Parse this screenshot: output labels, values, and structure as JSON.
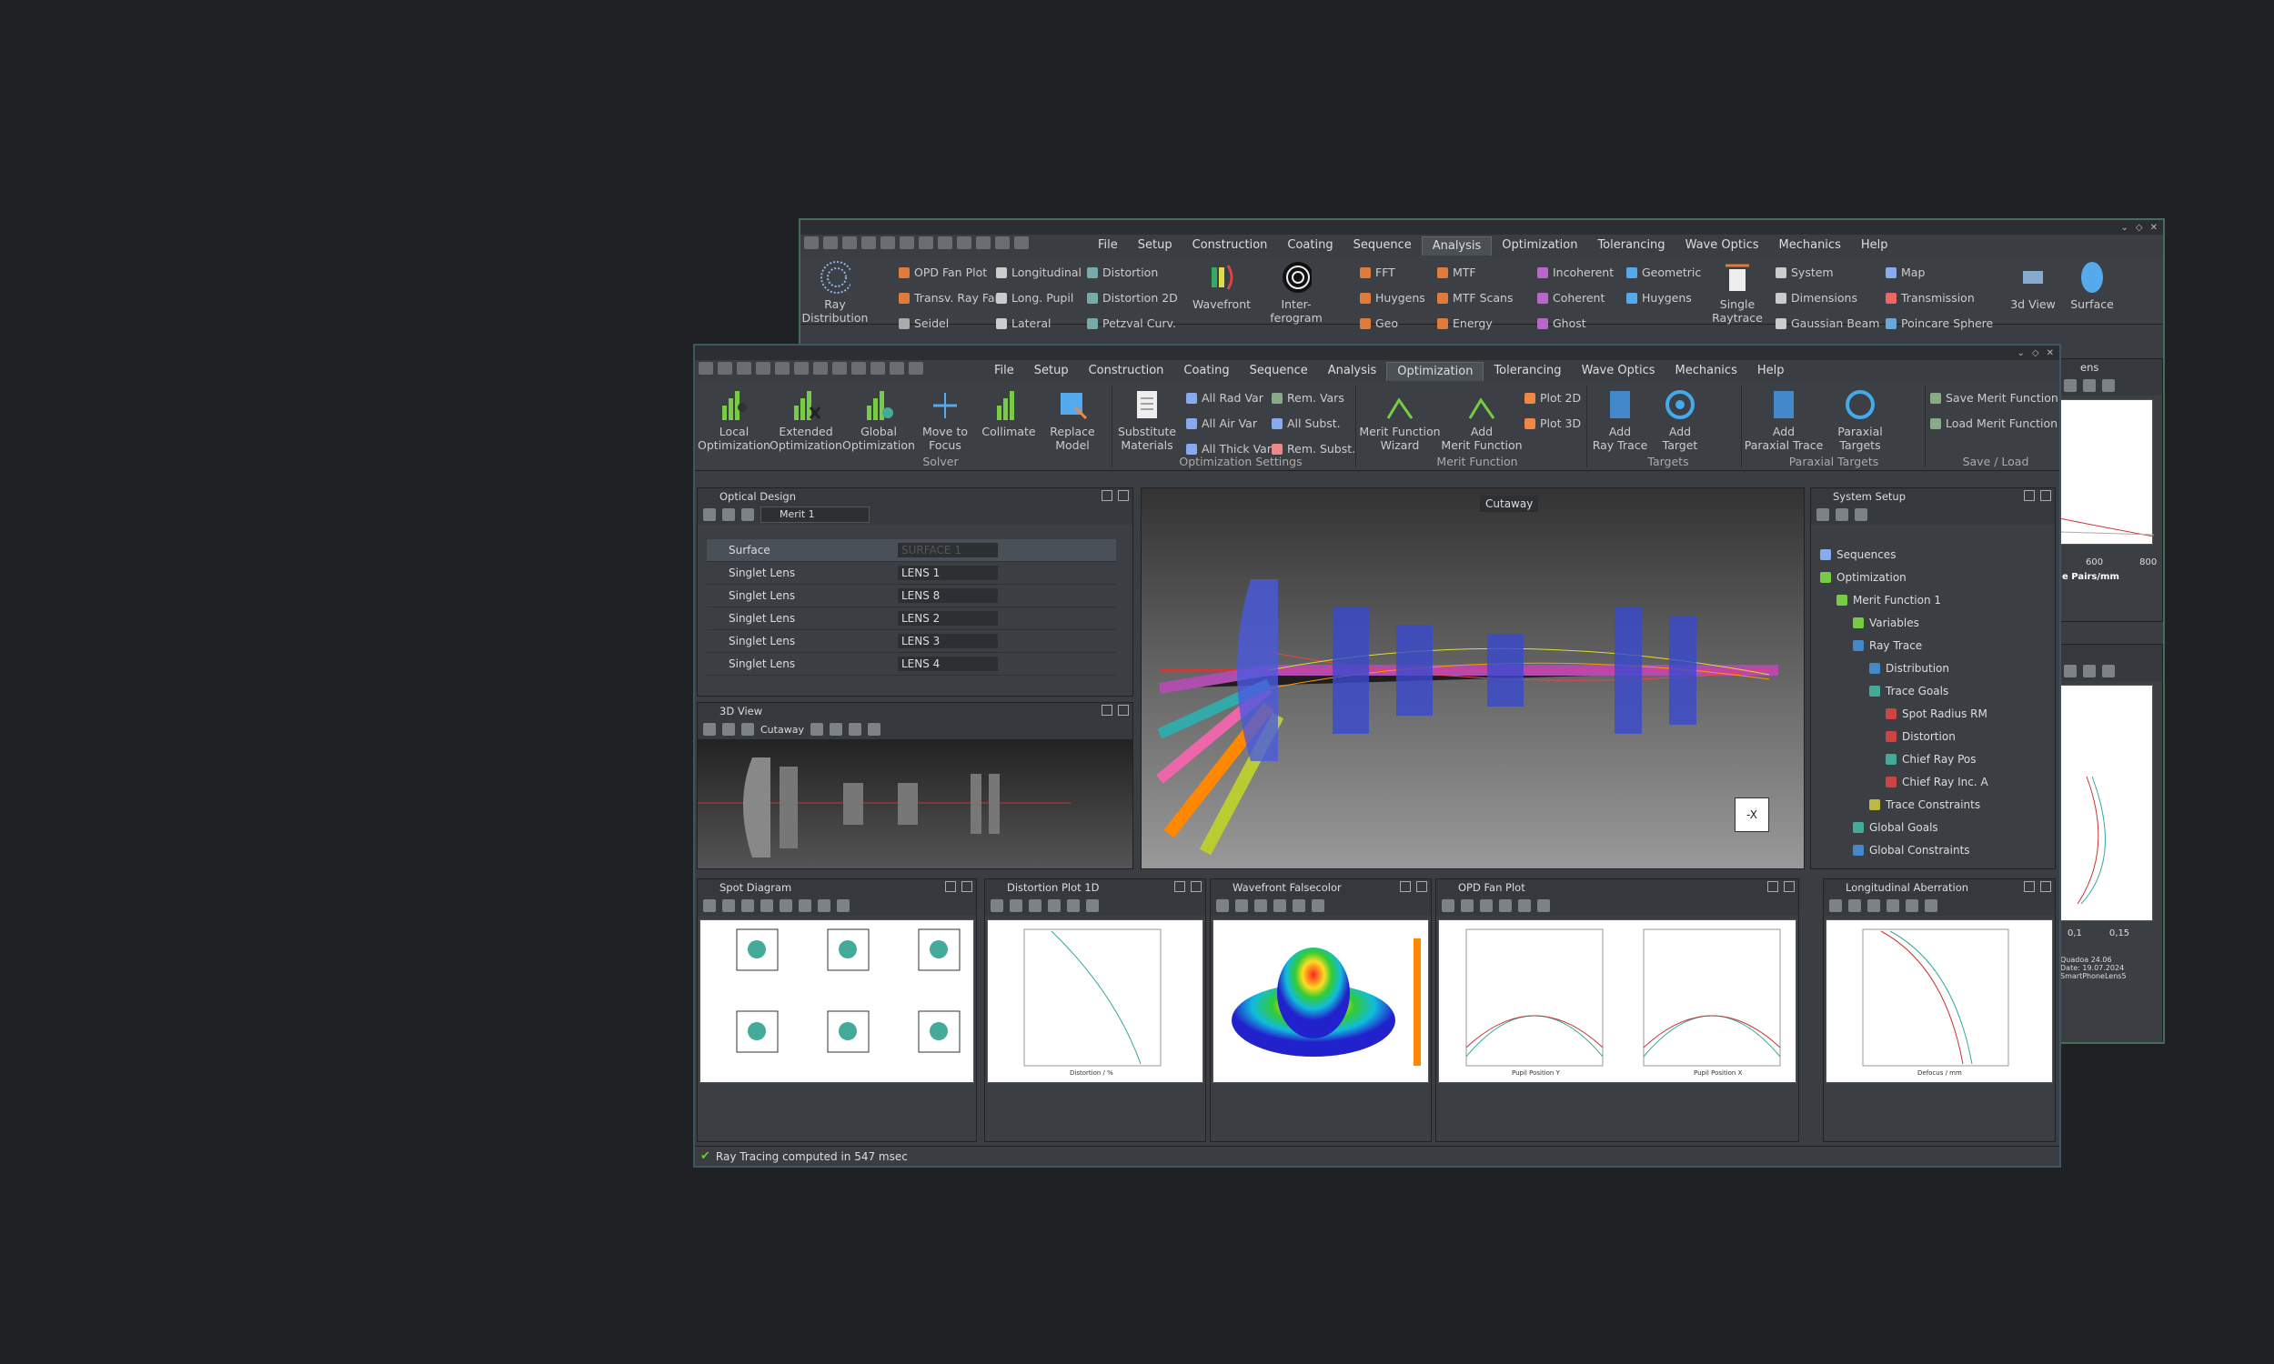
{
  "back": {
    "menu": [
      "File",
      "Setup",
      "Construction",
      "Coating",
      "Sequence",
      "Analysis",
      "Optimization",
      "Tolerancing",
      "Wave Optics",
      "Mechanics",
      "Help"
    ],
    "active": "Analysis",
    "buttons": {
      "ray_dist": "Ray\nDistribution",
      "wavefront": "Wavefront",
      "interferogram": "Inter-\nferogram",
      "single_raytrace": "Single\nRaytrace",
      "view3d": "3d View",
      "surface": "Surface"
    },
    "small": [
      "OPD Fan Plot",
      "Transv. Ray Fan",
      "Seidel",
      "Longitudinal",
      "Long. Pupil",
      "Lateral",
      "Distortion",
      "Distortion 2D",
      "Petzval Curv.",
      "FFT",
      "Huygens",
      "Geo",
      "MTF",
      "MTF Scans",
      "Energy",
      "Incoherent",
      "Coherent",
      "Ghost",
      "Geometric",
      "Huygens",
      "System",
      "Dimensions",
      "Gaussian Beam",
      "Map",
      "Transmission",
      "Poincare Sphere"
    ],
    "tab_label": "ens",
    "ticks": [
      "600",
      "800"
    ],
    "xlabel": "e Pairs/mm",
    "ticks2": [
      "0,1",
      "0,15"
    ],
    "foot": [
      "Quadoa 24.06",
      "Date: 19.07.2024",
      "SmartPhoneLens5"
    ]
  },
  "front": {
    "menu": [
      "File",
      "Setup",
      "Construction",
      "Coating",
      "Sequence",
      "Analysis",
      "Optimization",
      "Tolerancing",
      "Wave Optics",
      "Mechanics",
      "Help"
    ],
    "active": "Optimization",
    "buttons": {
      "local": "Local\nOptimization",
      "extended": "Extended\nOptimization",
      "global": "Global\nOptimization",
      "move": "Move to\nFocus",
      "collimate": "Collimate",
      "replace": "Replace\nModel",
      "substitute": "Substitute\nMaterials",
      "mfwizard": "Merit Function\nWizard",
      "addmf": "Add\nMerit Function",
      "addray": "Add\nRay Trace",
      "addtarget": "Add\nTarget",
      "addparaxial": "Add\nParaxial Trace",
      "paraxial": "Paraxial\nTargets"
    },
    "small": {
      "allrad": "All Rad Var",
      "allair": "All Air Var",
      "allthick": "All Thick Var",
      "remvars": "Rem. Vars",
      "allsubst": "All Subst.",
      "remsubst": "Rem. Subst.",
      "plot2d": "Plot 2D",
      "plot3d": "Plot 3D",
      "savemf": "Save Merit Function",
      "loadmf": "Load Merit Function"
    },
    "groups": {
      "solver": "Solver",
      "settings": "Optimization Settings",
      "merit": "Merit Function",
      "targets": "Targets",
      "paraxial": "Paraxial Targets",
      "saveload": "Save / Load"
    },
    "optical_design": {
      "title": "Optical Design",
      "merit": "Merit 1",
      "rows": [
        [
          "Surface",
          "SURFACE 1"
        ],
        [
          "Singlet Lens",
          "LENS 1"
        ],
        [
          "Singlet Lens",
          "LENS 8"
        ],
        [
          "Singlet Lens",
          "LENS 2"
        ],
        [
          "Singlet Lens",
          "LENS 3"
        ],
        [
          "Singlet Lens",
          "LENS 4"
        ]
      ]
    },
    "view3d": {
      "title": "3D View",
      "cutaway": "Cutaway"
    },
    "main_view": {
      "cutaway": "Cutaway",
      "axis": "-X"
    },
    "system_setup": {
      "title": "System Setup",
      "tree": [
        "Sequences",
        "Optimization",
        "Merit Function 1",
        "Variables",
        "Ray Trace",
        "Distribution",
        "Trace Goals",
        "Spot Radius RM",
        "Distortion",
        "Chief Ray Pos",
        "Chief Ray Inc. A",
        "Trace Constraints",
        "Global Goals",
        "Global Constraints"
      ]
    },
    "bottom": {
      "spot": "Spot Diagram",
      "distortion": "Distortion Plot 1D",
      "wavefront": "Wavefront Falsecolor",
      "opd": "OPD Fan Plot",
      "longab": "Longitudinal Aberration",
      "dist_x": "Distortion / %",
      "opd_x1": "Pupil Position Y",
      "opd_x2": "Pupil Position X",
      "long_x": "Defocus / mm"
    },
    "status": "Ray Tracing computed in 547 msec"
  }
}
